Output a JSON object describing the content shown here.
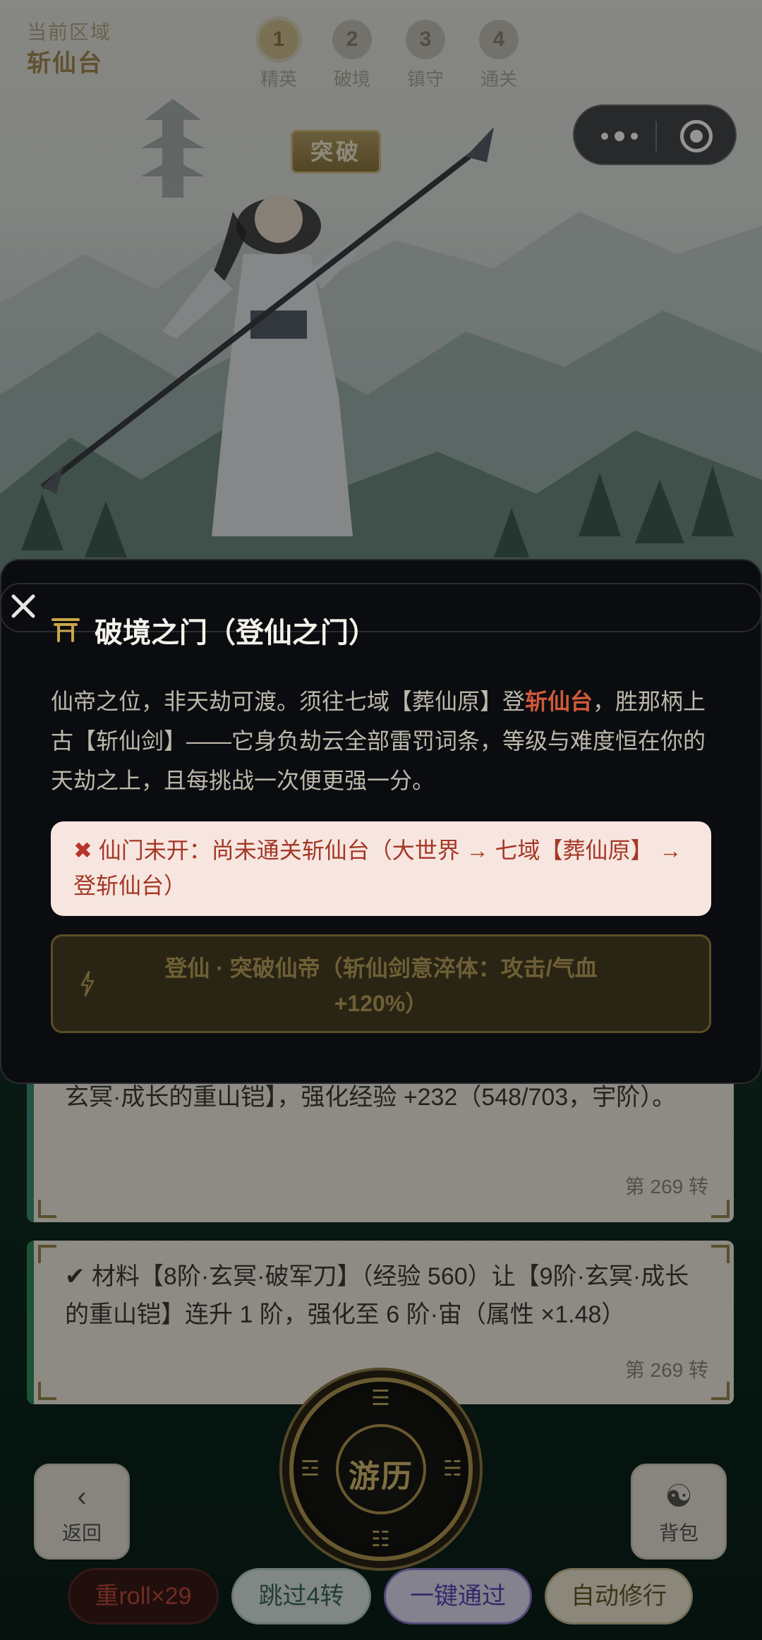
{
  "header": {
    "region_label": "当前区域",
    "region_name": "斩仙台",
    "steps": [
      {
        "num": "1",
        "label": "精英",
        "active": true
      },
      {
        "num": "2",
        "label": "破境",
        "active": false
      },
      {
        "num": "3",
        "label": "镇守",
        "active": false
      },
      {
        "num": "4",
        "label": "通关",
        "active": false
      }
    ],
    "breakthrough_tag": "突破"
  },
  "feed": {
    "cards": [
      {
        "text": "玄冥·成长的重山铠】，强化经验 +232（548/703，宇阶）。",
        "turn": "第 269 转"
      },
      {
        "text": "✔ 材料【8阶·玄冥·破军刀】（经验 560）让【9阶·玄冥·成长的重山铠】连升 1 阶，强化至 6 阶·宙（属性 ×1.48）",
        "turn": "第 269 转"
      }
    ]
  },
  "controls": {
    "back_label": "返回",
    "bag_label": "背包",
    "travel_label": "游历",
    "chips": [
      "重roll×29",
      "跳过4转",
      "一键通过",
      "自动修行"
    ]
  },
  "modal": {
    "title": "破境之门（登仙之门）",
    "desc_part1": "仙帝之位，非天劫可渡。须往七域【葬仙原】登",
    "desc_highlight": "斩仙台",
    "desc_part2": "，胜那柄上古【斩仙剑】——它身负劫云全部雷罚词条，等级与难度恒在你的天劫之上，且每挑战一次便更强一分。",
    "warning": "仙门未开：尚未通关斩仙台（大世界 → 七域【葬仙原】 → 登斩仙台）",
    "action_line1": "登仙 · 突破仙帝（斩仙剑意淬体：攻击/气血",
    "action_line2": "+120%）"
  },
  "colors": {
    "accent_gold": "#b59a52",
    "warning_red": "#a43826",
    "highlight_red": "#d05a3a",
    "card_stripe": "#3e8f7a"
  }
}
